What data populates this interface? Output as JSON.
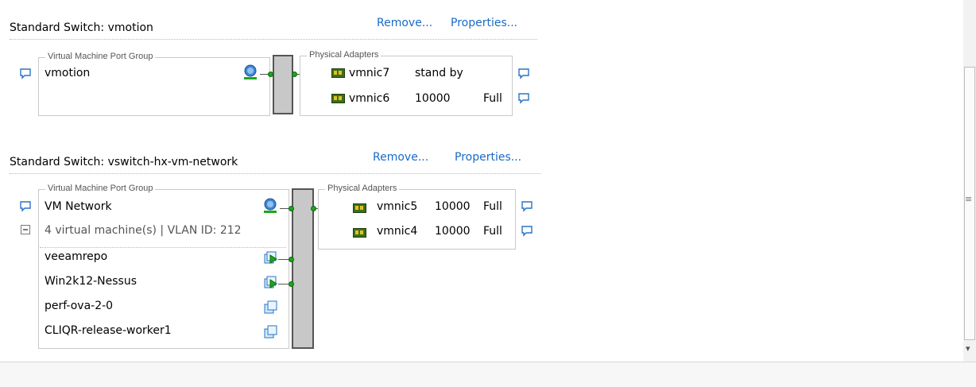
{
  "switches": [
    {
      "title": "Standard Switch: vmotion",
      "remove_label": "Remove...",
      "properties_label": "Properties...",
      "port_group": {
        "legend": "Virtual Machine Port Group",
        "name": "vmotion"
      },
      "adapters": {
        "legend": "Physical Adapters",
        "items": [
          {
            "name": "vmnic7",
            "speed": "stand by",
            "duplex": ""
          },
          {
            "name": "vmnic6",
            "speed": "10000",
            "duplex": "Full"
          }
        ]
      }
    },
    {
      "title": "Standard Switch: vswitch-hx-vm-network",
      "remove_label": "Remove...",
      "properties_label": "Properties...",
      "port_group": {
        "legend": "Virtual Machine Port Group",
        "name": "VM Network",
        "summary": "4 virtual machine(s) | VLAN ID: 212",
        "vms": [
          "veeamrepo",
          "Win2k12-Nessus",
          "perf-ova-2-0",
          "CLIQR-release-worker1"
        ]
      },
      "adapters": {
        "legend": "Physical Adapters",
        "items": [
          {
            "name": "vmnic5",
            "speed": "10000",
            "duplex": "Full"
          },
          {
            "name": "vmnic4",
            "speed": "10000",
            "duplex": "Full"
          }
        ]
      }
    }
  ],
  "scrollbar": {
    "grip": "≡",
    "down_arrow": "▾"
  },
  "icons": {
    "comment": "speech-bubble-icon",
    "nic": "network-adapter-icon",
    "portgroup": "port-group-globe-icon",
    "vm_on": "vm-powered-on-icon",
    "vm_off": "vm-powered-off-icon",
    "collapse": "collapse-icon"
  },
  "colors": {
    "link": "#1a6ac6",
    "connector": "#1ea51e"
  }
}
